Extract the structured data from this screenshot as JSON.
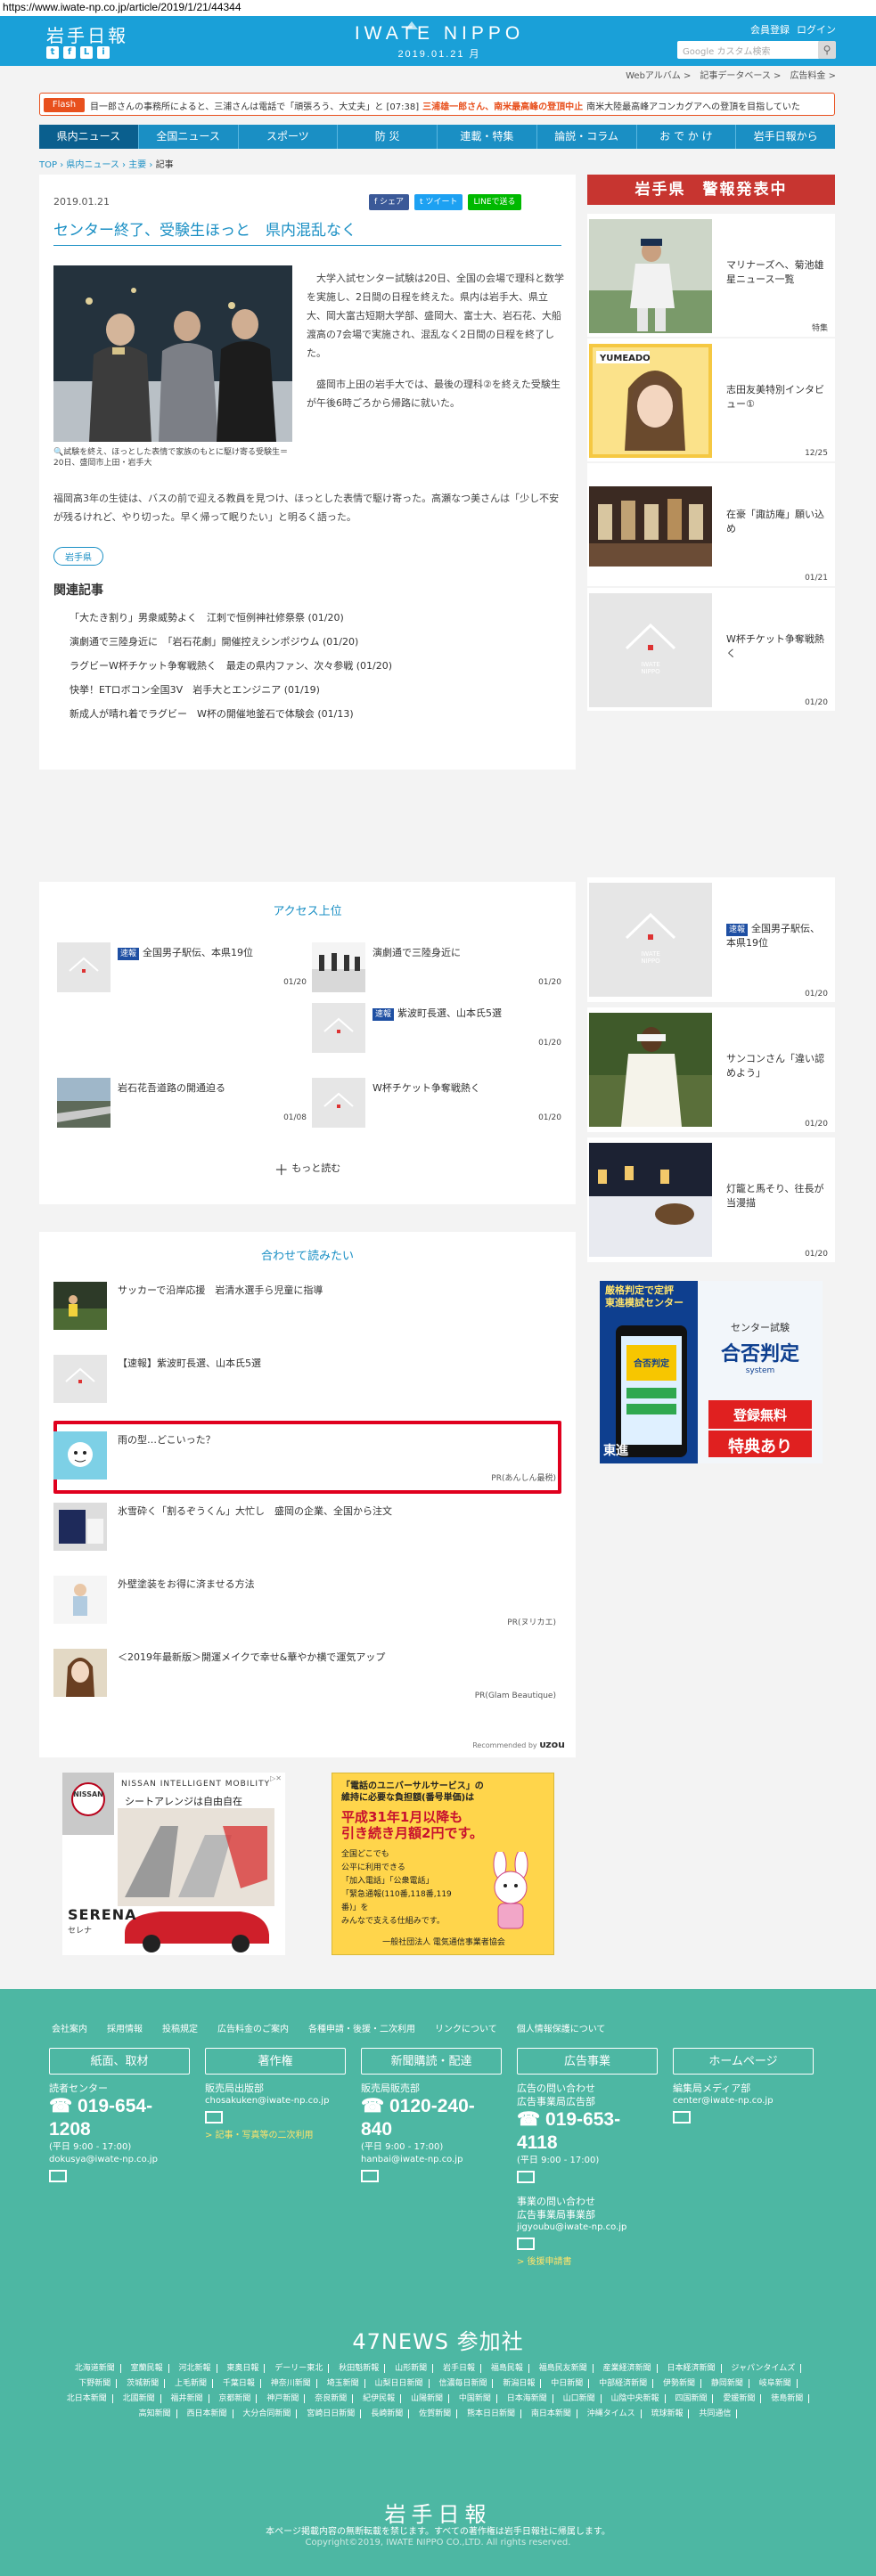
{
  "url": "https://www.iwate-np.co.jp/article/2019/1/21/44344",
  "header": {
    "logo": "岩手日報",
    "brand": "IWATE NIPPO",
    "date": "2019.01.21 月",
    "member": "会員登録",
    "login": "ログイン",
    "search_placeholder": "Google カスタム検索",
    "social": [
      "t",
      "f",
      "L",
      "i"
    ]
  },
  "sublinks": [
    "Webアルバム >",
    "記事データベース >",
    "広告料金 >"
  ],
  "flash": {
    "label": "Flash",
    "text": "目一郎さんの事務所によると、三浦さんは電話で「頑張ろう、大丈夫」と",
    "time": "[07:38]",
    "headline": "三浦雄一郎さん、南米最高峰の登頂中止",
    "tail": "南米大陸最高峰アコンカグアへの登頂を目指していた"
  },
  "nav": [
    "県内ニュース",
    "全国ニュース",
    "スポーツ",
    "防 災",
    "連載・特集",
    "論説・コラム",
    "お で か け",
    "岩手日報から"
  ],
  "crumb": {
    "top": "TOP",
    "l1": "県内ニュース",
    "l2": "主要",
    "cur": "記事"
  },
  "article": {
    "date": "2019.01.21",
    "share": "シェア",
    "tweet": "ツイート",
    "line": "LINEで送る",
    "title": "センター終了、受験生ほっと　県内混乱なく",
    "caption": "試験を終え、ほっとした表情で家族のもとに駆け寄る受験生＝20日、盛岡市上田・岩手大",
    "p1": "大学入試センター試験は20日、全国の会場で理科と数学を実施し、2日間の日程を終えた。県内は岩手大、県立大、岡大富古短期大学部、盛岡大、富士大、岩石花、大船渡高の7会場で実施され、混乱なく2日間の日程を終了した。",
    "p2": "盛岡市上田の岩手大では、最後の理科②を終えた受験生が午後6時ごろから帰路に就いた。",
    "p3": "福岡高3年の生徒は、バスの前で迎える教員を見つけ、ほっとした表情で駆け寄った。高瀬なつ美さんは「少し不安が残るけれど、やり切った。早く帰って眠りたい」と明るく語った。",
    "tag": "岩手県",
    "related_heading": "関連記事",
    "related": [
      "「大たき割り」男衆威勢よく　江刺で恒例神社修祭祭 (01/20)",
      "演劇通で三陸身近に　「岩石花劇」開催控えシンポジウム (01/20)",
      "ラグビーW杯チケット争奪戦熱く　最走の県内ファン、次々参戦 (01/20)",
      "快挙！ETロボコン全国3V　岩手大とエンジニア (01/19)",
      "新成人が晴れ着でラグビー　W杯の開催地釜石で体験会 (01/13)"
    ]
  },
  "side1": {
    "warning": "岩手県　警報発表中",
    "cards": [
      {
        "text": "マリナーズへ、菊池雄星ニュース一覧",
        "date": "特集"
      },
      {
        "text": "志田友美特別インタビュー①",
        "date": "12/25"
      },
      {
        "text": "在豪「諏訪庵」願い込め",
        "date": "01/21"
      },
      {
        "text": "W杯チケット争奪戦熱く",
        "date": "01/20"
      }
    ]
  },
  "access": {
    "heading": "アクセス上位",
    "items": [
      {
        "badge": "速報",
        "text": "全国男子駅伝、本県19位",
        "date": "01/20"
      },
      {
        "badge": "",
        "text": "演劇通で三陸身近に",
        "date": "01/20"
      },
      {
        "badge": "速報",
        "text": "紫波町長選、山本氏5選",
        "date": "01/20"
      },
      {
        "badge": "",
        "text": "岩石花吾道路の開通迫る",
        "date": "01/08"
      },
      {
        "badge": "",
        "text": "W杯チケット争奪戦熱く",
        "date": "01/20"
      }
    ],
    "more": "もっと読む"
  },
  "recommend": {
    "heading": "合わせて読みたい",
    "items": [
      {
        "text": "サッカーで沿岸応援　岩清水選手ら児童に指導",
        "pr": ""
      },
      {
        "text": "【速報】紫波町長選、山本氏5選",
        "pr": ""
      },
      {
        "text": "雨の型…どこいった？",
        "pr": "PR(あんしん最税)"
      },
      {
        "text": "氷雪砕く「割るぞうくん」大忙し　盛岡の企業、全国から注文",
        "pr": ""
      },
      {
        "text": "外壁塗装をお得に済ませる方法",
        "pr": "PR(ヌリカエ)"
      },
      {
        "text": "＜2019年最新版＞開運メイクで幸せ&華やか横で運気アップ",
        "pr": "PR(Glam Beautique)"
      }
    ],
    "by": "Recommended by",
    "by_brand": "ᴜzou"
  },
  "side2": [
    {
      "badge": "速報",
      "text": "全国男子駅伝、本県19位",
      "date": "01/20"
    },
    {
      "badge": "",
      "text": "サンコンさん「違い認めよう」",
      "date": "01/20"
    },
    {
      "badge": "",
      "text": "灯籠と馬そり、往長が当漫描",
      "date": "01/20"
    }
  ],
  "ads": {
    "toshin": {
      "t1": "厳格判定で定評",
      "t2": "東進模試センター",
      "t3": "合否判定",
      "t4": "センター試験",
      "t5": "合否判定",
      "t6": "登録無料",
      "t7": "特典あり",
      "t8": "system",
      "logo": "東進"
    },
    "nissan": {
      "brand": "NISSAN",
      "mobility": "NISSAN INTELLIGENT MOBILITY",
      "copy": "シートアレンジは自由自在",
      "car": "SERENA",
      "car_jp": "セレナ"
    },
    "universal": {
      "l1": "「電話のユニバーサルサービス」の",
      "l2": "維持に必要な負担額(番号単価)は",
      "l3": "平成31年1月以降も",
      "l4": "引き続き月額2円です。",
      "l5": "全国どこでも",
      "l6": "公平に利用できる",
      "l7": "「加入電話」「公衆電話」",
      "l8": "「緊急通報(110番,118番,119番)」を",
      "l9": "みんなで支える仕組みです。",
      "l10": "一般社団法人 電気通信事業者協会"
    }
  },
  "footer": {
    "links": [
      "会社案内",
      "採用情報",
      "投稿規定",
      "広告料金のご案内",
      "各種申請・後援・二次利用",
      "リンクについて",
      "個人情報保護について"
    ],
    "cols": [
      {
        "btn": "紙面、取材",
        "l1": "読者センター",
        "phone": "019-654-1208",
        "hours": "(平日 9:00 - 17:00)",
        "mail": "dokusya@iwate-np.co.jp",
        "extra": "",
        "l2": "",
        "phone2": "",
        "hours2": "",
        "mail2": "",
        "extra2": ""
      },
      {
        "btn": "著作権",
        "l1": "販売局出版部",
        "phone": "",
        "hours": "",
        "mail": "chosakuken@iwate-np.co.jp",
        "extra": "> 記事・写真等の二次利用",
        "l2": "",
        "phone2": "",
        "hours2": "",
        "mail2": "",
        "extra2": ""
      },
      {
        "btn": "新聞購読・配達",
        "l1": "販売局販売部",
        "phone": "0120-240-840",
        "hours": "(平日 9:00 - 17:00)",
        "mail": "hanbai@iwate-np.co.jp",
        "extra": "",
        "l2": "",
        "phone2": "",
        "hours2": "",
        "mail2": "",
        "extra2": ""
      },
      {
        "btn": "広告事業",
        "l1": "広告の問い合わせ",
        "l1b": "広告事業局広告部",
        "phone": "019-653-4118",
        "hours": "(平日 9:00 - 17:00)",
        "mail": "",
        "extra": "",
        "l2": "事業の問い合わせ",
        "l2b": "広告事業局事業部",
        "mail2": "jigyoubu@iwate-np.co.jp",
        "extra2": "> 後援申請書"
      },
      {
        "btn": "ホームページ",
        "l1": "編集局メディア部",
        "phone": "",
        "hours": "",
        "mail": "center@iwate-np.co.jp",
        "extra": "",
        "l2": "",
        "phone2": "",
        "hours2": "",
        "mail2": "",
        "extra2": ""
      }
    ],
    "n47_title": "47NEWS 参加社",
    "n47": [
      "北海道新聞",
      "室蘭民報",
      "河北新報",
      "東奥日報",
      "デーリー東北",
      "秋田魁新報",
      "山形新聞",
      "岩手日報",
      "福島民報",
      "福島民友新聞",
      "産業経済新聞",
      "日本経済新聞",
      "ジャパンタイムズ",
      "下野新聞",
      "茨城新聞",
      "上毛新聞",
      "千葉日報",
      "神奈川新聞",
      "埼玉新聞",
      "山梨日日新聞",
      "信濃毎日新聞",
      "新潟日報",
      "中日新聞",
      "中部経済新聞",
      "伊勢新聞",
      "静岡新聞",
      "岐阜新聞",
      "北日本新聞",
      "北國新聞",
      "福井新聞",
      "京都新聞",
      "神戸新聞",
      "奈良新聞",
      "紀伊民報",
      "山陽新聞",
      "中国新聞",
      "日本海新聞",
      "山口新聞",
      "山陰中央新報",
      "四国新聞",
      "愛媛新聞",
      "徳島新聞",
      "高知新聞",
      "西日本新聞",
      "大分合同新聞",
      "宮崎日日新聞",
      "長崎新聞",
      "佐賀新聞",
      "熊本日日新聞",
      "南日本新聞",
      "沖縄タイムス",
      "琉球新報",
      "共同通信"
    ],
    "logo": "岩手日報",
    "note": "本ページ掲載内容の無断転載を禁じます。すべての著作権は岩手日報社に帰属します。",
    "copyright": "Copyright©2019, IWATE NIPPO CO.,LTD. All rights reserved."
  }
}
